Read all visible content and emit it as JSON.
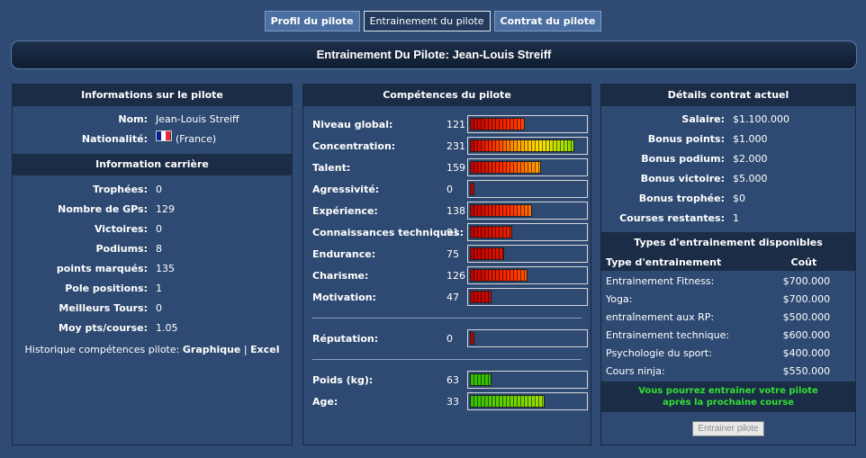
{
  "tabs": [
    "Profil du pilote",
    "Entrainement du pilote",
    "Contrat du pilote"
  ],
  "page_title": "Entrainement Du Pilote: Jean-Louis Streiff",
  "info": {
    "heading": "Informations sur le pilote",
    "name_label": "Nom:",
    "name": "Jean-Louis Streiff",
    "nat_label": "Nationalité:",
    "nationality": "(France)",
    "flag_colors": [
      "#002395",
      "#ffffff",
      "#ed2939"
    ]
  },
  "career": {
    "heading": "Information carrière",
    "rows": [
      {
        "label": "Trophées:",
        "value": "0"
      },
      {
        "label": "Nombre de GPs:",
        "value": "129"
      },
      {
        "label": "Victoires:",
        "value": "0"
      },
      {
        "label": "Podiums:",
        "value": "8"
      },
      {
        "label": "points marqués:",
        "value": "135"
      },
      {
        "label": "Pole positions:",
        "value": "1"
      },
      {
        "label": "Meilleurs Tours:",
        "value": "0"
      },
      {
        "label": "Moy pts/course:",
        "value": "1.05"
      }
    ],
    "history_label": "Historique compétences pilote:",
    "history_graph": "Graphique",
    "history_sep": "|",
    "history_excel": "Excel"
  },
  "skills": {
    "heading": "Compétences du pilote",
    "items": [
      {
        "label": "Niveau global:",
        "value": "121",
        "level": 0.48
      },
      {
        "label": "Concentration:",
        "value": "231",
        "level": 0.91
      },
      {
        "label": "Talent:",
        "value": "159",
        "level": 0.62
      },
      {
        "label": "Agressivité:",
        "value": "0",
        "level": 0.04
      },
      {
        "label": "Expérience:",
        "value": "138",
        "level": 0.54
      },
      {
        "label": "Connaissances techniques:",
        "value": "91",
        "level": 0.37
      },
      {
        "label": "Endurance:",
        "value": "75",
        "level": 0.3
      },
      {
        "label": "Charisme:",
        "value": "126",
        "level": 0.5
      },
      {
        "label": "Motivation:",
        "value": "47",
        "level": 0.19
      }
    ],
    "reputation": {
      "label": "Réputation:",
      "value": "0",
      "level": 0.04
    },
    "physical": [
      {
        "label": "Poids (kg):",
        "value": "63",
        "level": 0.19,
        "scale": "green"
      },
      {
        "label": "Age:",
        "value": "33",
        "level": 0.65,
        "scale": "age"
      }
    ]
  },
  "contract": {
    "heading": "Détails contrat actuel",
    "rows": [
      {
        "label": "Salaire:",
        "value": "$1.100.000"
      },
      {
        "label": "Bonus points:",
        "value": "$1.000"
      },
      {
        "label": "Bonus podium:",
        "value": "$2.000"
      },
      {
        "label": "Bonus victoire:",
        "value": "$5.000"
      },
      {
        "label": "Bonus trophée:",
        "value": "$0"
      },
      {
        "label": "Courses restantes:",
        "value": "1"
      }
    ]
  },
  "training": {
    "heading": "Types d'entrainement disponibles",
    "col_type": "Type d'entrainement",
    "col_cost": "Coût",
    "rows": [
      {
        "type": "Entrainement Fitness:",
        "cost": "$700.000"
      },
      {
        "type": "Yoga:",
        "cost": "$700.000"
      },
      {
        "type": "entraînement aux RP:",
        "cost": "$500.000"
      },
      {
        "type": "Entrainement technique:",
        "cost": "$600.000"
      },
      {
        "type": "Psychologie du sport:",
        "cost": "$400.000"
      },
      {
        "type": "Cours ninja:",
        "cost": "$550.000"
      }
    ],
    "notice_line1": "Vous pourrez entraîner votre pilote",
    "notice_line2": "après la prochaine course",
    "button": "Entrainer pilote"
  }
}
